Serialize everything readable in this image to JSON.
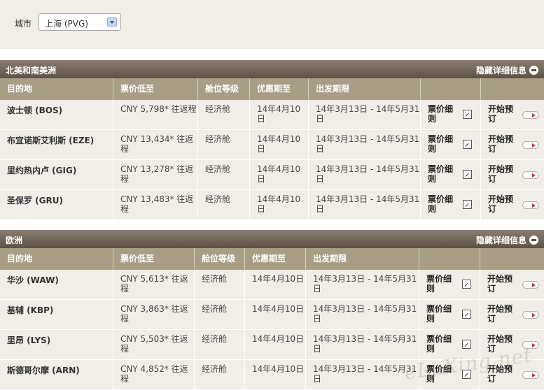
{
  "filter": {
    "label": "城市",
    "selected": "上海 (PVG)"
  },
  "sections": [
    {
      "title": "北美和南美洲",
      "toggle": "隐藏详细信息",
      "columns": [
        "目的地",
        "票价低至",
        "舱位等级",
        "优惠期至",
        "出发期限",
        "",
        ""
      ],
      "rows": [
        {
          "dest": "波士顿 (BOS)",
          "price": "CNY 5,798* 往返程",
          "cabin": "经济舱",
          "valid": "14年4月10日",
          "depart": "14年3月13日 - 14年5月31日",
          "rules": "票价细则",
          "book": "开始预订"
        },
        {
          "dest": "布宜诺斯艾利斯 (EZE)",
          "price": "CNY 13,434* 往返程",
          "cabin": "经济舱",
          "valid": "14年4月10日",
          "depart": "14年3月13日 - 14年5月31日",
          "rules": "票价细则",
          "book": "开始预订"
        },
        {
          "dest": "里约热内卢 (GIG)",
          "price": "CNY 13,278* 往返程",
          "cabin": "经济舱",
          "valid": "14年4月10日",
          "depart": "14年3月13日 - 14年5月31日",
          "rules": "票价细则",
          "book": "开始预订"
        },
        {
          "dest": "圣保罗 (GRU)",
          "price": "CNY 13,483* 往返程",
          "cabin": "经济舱",
          "valid": "14年4月10日",
          "depart": "14年3月13日 - 14年5月31日",
          "rules": "票价细则",
          "book": "开始预订"
        }
      ]
    },
    {
      "title": "欧洲",
      "toggle": "隐藏详细信息",
      "columns": [
        "目的地",
        "票价低至",
        "舱位等级",
        "优惠期至",
        "出发期限",
        "",
        ""
      ],
      "rows": [
        {
          "dest": "华沙 (WAW)",
          "price": "CNY 5,613* 往返程",
          "cabin": "经济舱",
          "valid": "14年4月10日",
          "depart": "14年3月13日 - 14年5月31日",
          "rules": "票价细则",
          "book": "开始预订"
        },
        {
          "dest": "基辅 (KBP)",
          "price": "CNY 3,863* 往返程",
          "cabin": "经济舱",
          "valid": "14年4月10日",
          "depart": "14年3月13日 - 14年5月31日",
          "rules": "票价细则",
          "book": "开始预订"
        },
        {
          "dest": "里昂 (LYS)",
          "price": "CNY 5,503* 往返程",
          "cabin": "经济舱",
          "valid": "14年4月10日",
          "depart": "14年3月13日 - 14年5月31日",
          "rules": "票价细则",
          "book": "开始预订"
        },
        {
          "dest": "斯德哥尔摩 (ARN)",
          "price": "CNY 4,852* 往返程",
          "cabin": "经济舱",
          "valid": "14年4月10日",
          "depart": "14年3月13日 - 14年5月31日",
          "rules": "票价细则",
          "book": "开始预订"
        }
      ]
    }
  ],
  "watermark": "eLuXing.net",
  "icons": {
    "rules": "external-link-icon",
    "book": "arrow-right-icon",
    "toggle": "minus-circle-icon",
    "dropdown": "chevron-down-icon"
  },
  "colors": {
    "header": "#5e5146",
    "columns": "#a89e86",
    "row": "#f1eee8",
    "accent": "#c0392b"
  }
}
